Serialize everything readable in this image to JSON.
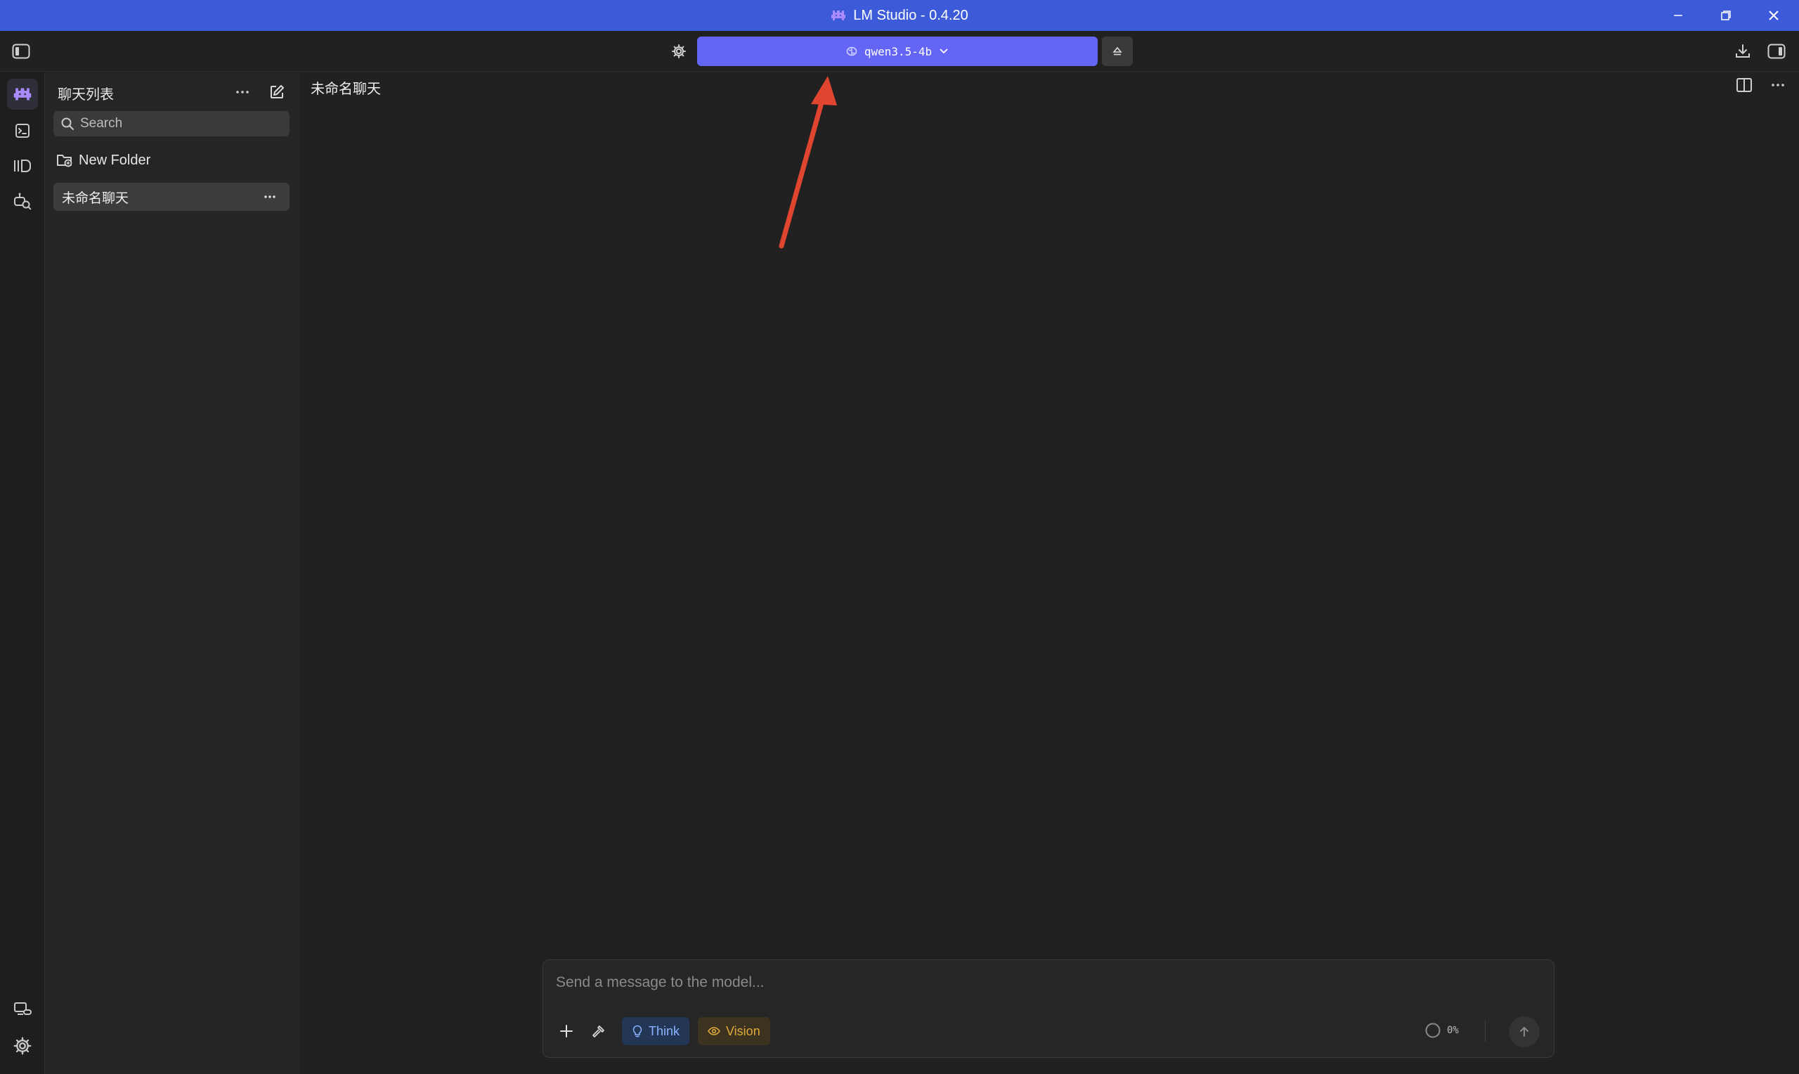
{
  "window": {
    "title": "LM Studio - 0.4.20"
  },
  "toolbar": {
    "model_name": "qwen3.5-4b"
  },
  "sidebar": {
    "title": "聊天列表",
    "search_placeholder": "Search",
    "new_folder_label": "New Folder",
    "chats": [
      {
        "label": "未命名聊天",
        "selected": true
      }
    ]
  },
  "main": {
    "chat_title": "未命名聊天"
  },
  "composer": {
    "placeholder": "Send a message to the model...",
    "think_label": "Think",
    "vision_label": "Vision",
    "context_usage": "0%"
  },
  "colors": {
    "title_bar": "#3d5bd9",
    "model_button": "#6366f5",
    "annotation_arrow": "#e0452f"
  }
}
